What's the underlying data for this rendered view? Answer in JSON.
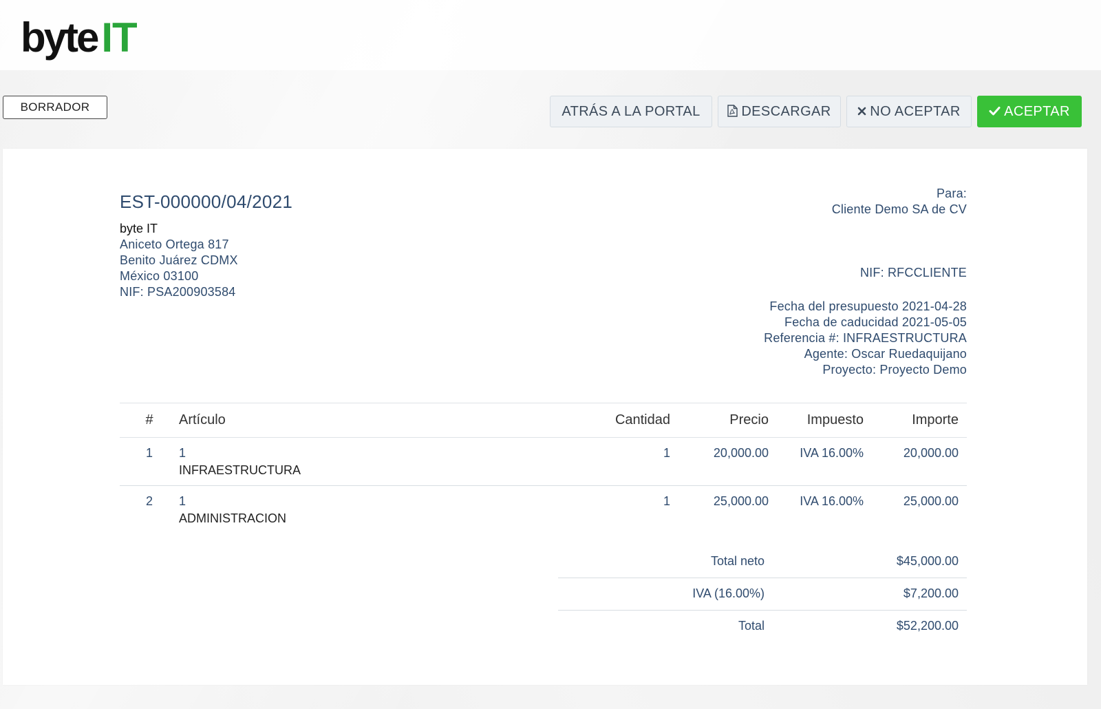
{
  "brand": {
    "logo_part1": "byte",
    "logo_part2": "IT",
    "accent": "#2aa53a"
  },
  "status": {
    "label": "BORRADOR"
  },
  "actions": {
    "back_label": "ATRÁS A LA PORTAL",
    "download_label": "DESCARGAR",
    "reject_label": "NO ACEPTAR",
    "accept_label": "ACEPTAR",
    "accept_color": "#39c138",
    "download_icon": "file-pdf-icon",
    "reject_icon": "x-icon",
    "accept_icon": "check-icon"
  },
  "estimate": {
    "number": "EST-000000/04/2021",
    "company": {
      "name": "byte IT",
      "address1": "Aniceto Ortega 817",
      "address2": "Benito Juárez CDMX",
      "address3": "México 03100",
      "nif": "NIF: PSA200903584"
    },
    "to": {
      "label": "Para:",
      "client": "Cliente Demo SA de CV",
      "nif": "NIF: RFCCLIENTE"
    },
    "meta": {
      "date": "Fecha del presupuesto 2021-04-28",
      "expiry": "Fecha de caducidad 2021-05-05",
      "reference": "Referencia #: INFRAESTRUCTURA",
      "agent": "Agente: Oscar Ruedaquijano",
      "project": "Proyecto: Proyecto Demo"
    }
  },
  "table": {
    "headers": [
      "#",
      "Artículo",
      "Cantidad",
      "Precio",
      "Impuesto",
      "Importe"
    ],
    "rows": [
      {
        "num": "1",
        "item": "1",
        "desc": "INFRAESTRUCTURA",
        "qty": "1",
        "price": "20,000.00",
        "tax": "IVA 16.00%",
        "amount": "20,000.00"
      },
      {
        "num": "2",
        "item": "1",
        "desc": "ADMINISTRACION",
        "qty": "1",
        "price": "25,000.00",
        "tax": "IVA 16.00%",
        "amount": "25,000.00"
      }
    ]
  },
  "totals": {
    "net_label": "Total neto",
    "net_value": "$45,000.00",
    "tax_label": "IVA (16.00%)",
    "tax_value": "$7,200.00",
    "total_label": "Total",
    "total_value": "$52,200.00"
  }
}
